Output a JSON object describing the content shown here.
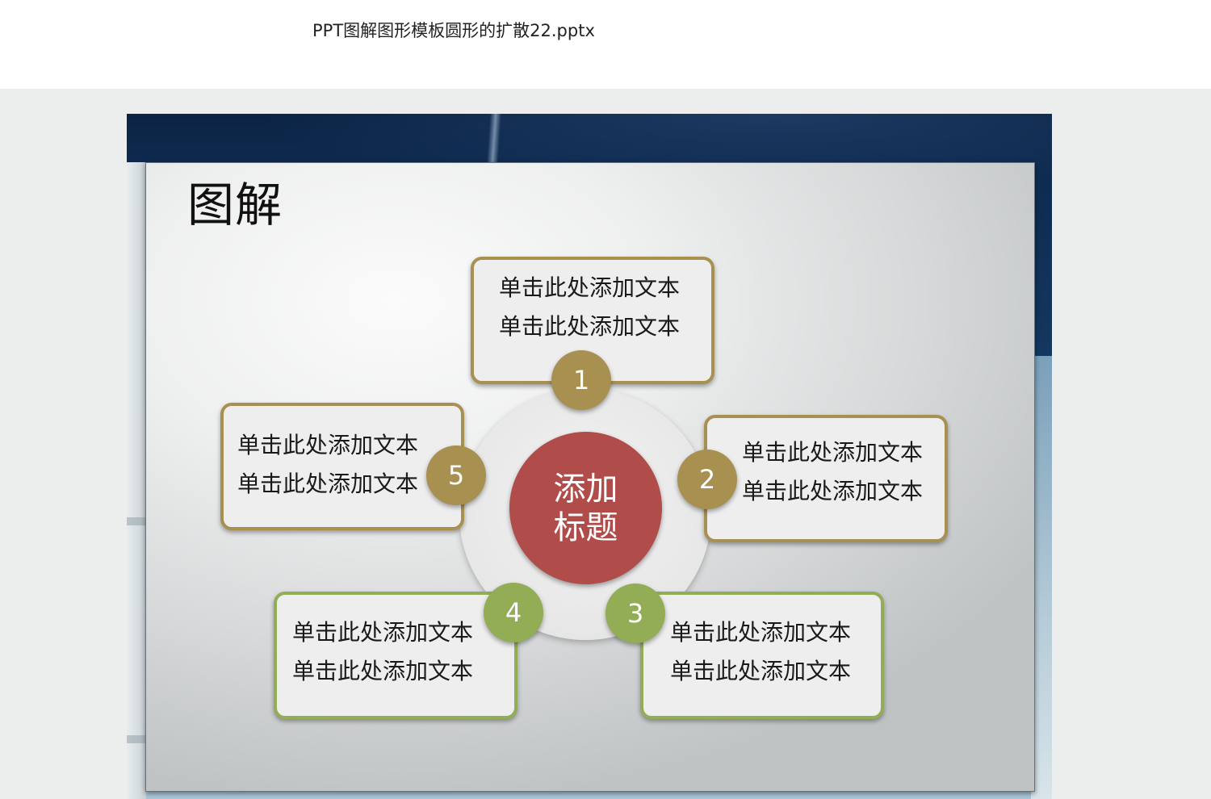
{
  "document": {
    "title": "PPT图解图形模板圆形的扩散22.pptx"
  },
  "slide": {
    "heading": "图解",
    "center": {
      "line1": "添加",
      "line2": "标题",
      "color": "#b04d4a"
    },
    "items": [
      {
        "number": "1",
        "line1": "单击此处添加文本",
        "line2": "单击此处添加文本",
        "color": "#a89050"
      },
      {
        "number": "2",
        "line1": "单击此处添加文本",
        "line2": "单击此处添加文本",
        "color": "#a89050"
      },
      {
        "number": "3",
        "line1": "单击此处添加文本",
        "line2": "单击此处添加文本",
        "color": "#93ad57"
      },
      {
        "number": "4",
        "line1": "单击此处添加文本",
        "line2": "单击此处添加文本",
        "color": "#93ad57"
      },
      {
        "number": "5",
        "line1": "单击此处添加文本",
        "line2": "单击此处添加文本",
        "color": "#a89050"
      }
    ]
  }
}
